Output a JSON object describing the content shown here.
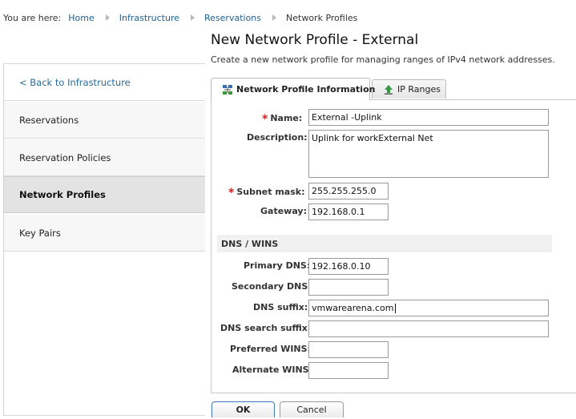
{
  "breadcrumb": {
    "prefix": "You are here:",
    "items": [
      "Home",
      "Infrastructure",
      "Reservations"
    ],
    "current": "Network Profiles"
  },
  "page": {
    "title": "New Network Profile - External",
    "description": "Create a new network profile for managing ranges of IPv4 network addresses."
  },
  "sidebar": {
    "items": [
      {
        "label": "< Back to Infrastructure"
      },
      {
        "label": "Reservations"
      },
      {
        "label": "Reservation Policies"
      },
      {
        "label": "Network Profiles"
      },
      {
        "label": "Key Pairs"
      }
    ]
  },
  "tabs": [
    {
      "label": "Network Profile Information",
      "icon": "network-profile-icon"
    },
    {
      "label": "IP Ranges",
      "icon": "ip-ranges-icon"
    }
  ],
  "form": {
    "name_label": "Name:",
    "name_value": "External -Uplink",
    "description_label": "Description:",
    "description_value": "Uplink for workExternal Net",
    "subnet_label": "Subnet mask:",
    "subnet_value": "255.255.255.0",
    "gateway_label": "Gateway:",
    "gateway_value": "192.168.0.1",
    "section_label": "DNS / WINS",
    "primary_dns_label": "Primary DNS:",
    "primary_dns_value": "192.168.0.10",
    "secondary_dns_label": "Secondary DNS:",
    "secondary_dns_value": "",
    "dns_suffix_label": "DNS suffix:",
    "dns_suffix_value": "vmwarearena.com",
    "dns_search_suffix_label": "DNS search suffix:",
    "dns_search_suffix_value": "",
    "preferred_wins_label": "Preferred WINS:",
    "preferred_wins_value": "",
    "alternate_wins_label": "Alternate WINS:",
    "alternate_wins_value": "",
    "required_marker": "*"
  },
  "buttons": {
    "ok": "OK",
    "cancel": "Cancel"
  },
  "colors": {
    "link": "#1f5f8f",
    "required": "#cc2222",
    "active_sidebar_bg": "#e3e3e3"
  }
}
